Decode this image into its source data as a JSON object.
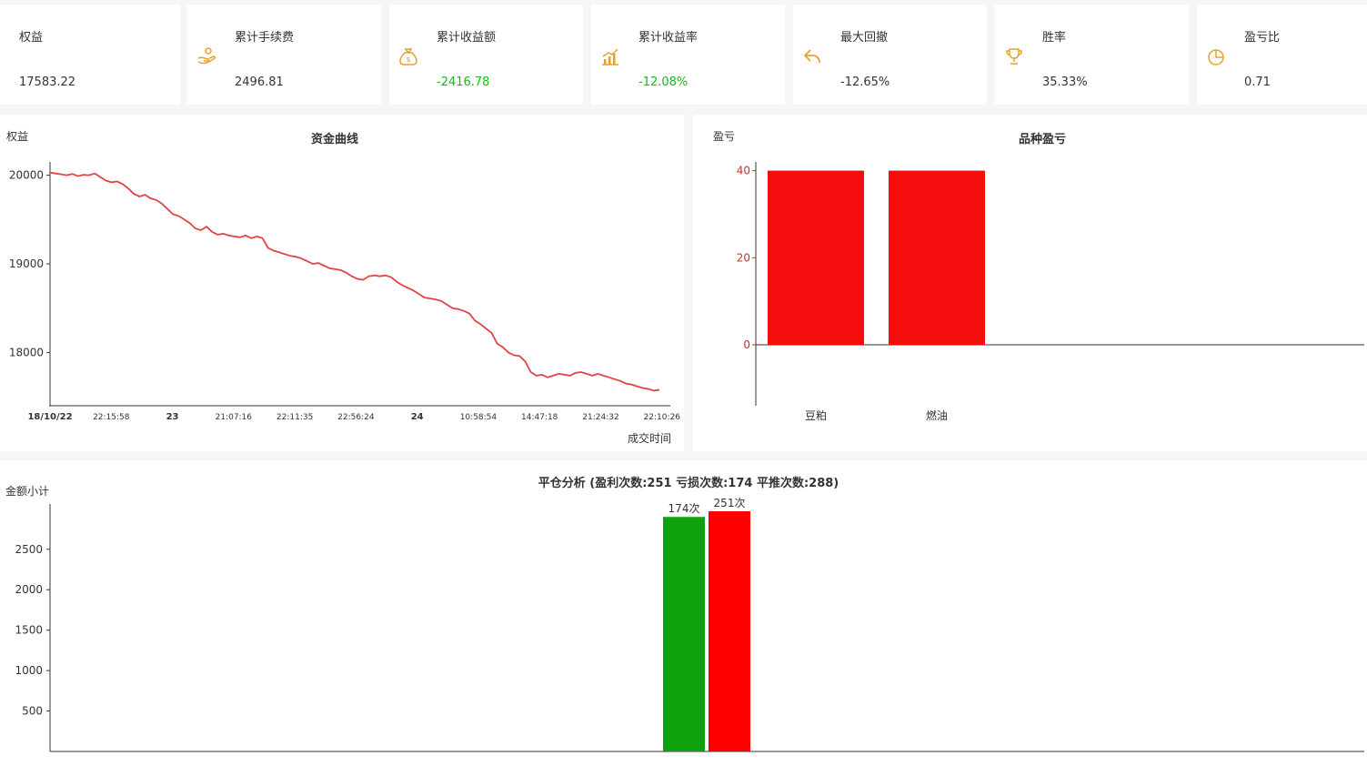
{
  "colors": {
    "accent": "#e8a02a",
    "negative": "#19b919",
    "line": "#e04545",
    "bar_red": "#f50d0d",
    "bar_green": "#0ea10e",
    "bar_red2": "#ff0000"
  },
  "stats": [
    {
      "label": "权益",
      "value": "17583.22",
      "icon": "coins-icon",
      "tone": "normal"
    },
    {
      "label": "累计手续费",
      "value": "2496.81",
      "icon": "hand-coin-icon",
      "tone": "normal"
    },
    {
      "label": "累计收益额",
      "value": "-2416.78",
      "icon": "money-bag-icon",
      "tone": "negative"
    },
    {
      "label": "累计收益率",
      "value": "-12.08%",
      "icon": "rising-chart-icon",
      "tone": "negative"
    },
    {
      "label": "最大回撤",
      "value": "-12.65%",
      "icon": "undo-arrow-icon",
      "tone": "normal"
    },
    {
      "label": "胜率",
      "value": "35.33%",
      "icon": "trophy-icon",
      "tone": "normal"
    },
    {
      "label": "盈亏比",
      "value": "0.71",
      "icon": "pie-chart-icon",
      "tone": "normal"
    }
  ],
  "chart_data": [
    {
      "type": "line",
      "title": "资金曲线",
      "ylabel": "权益",
      "xlabel": "成交时间",
      "ylim": [
        17400,
        20150
      ],
      "yticks": [
        18000,
        19000,
        20000
      ],
      "xticks": [
        "18/10/22",
        "22:15:58",
        "23",
        "21:07:16",
        "22:11:35",
        "22:56:24",
        "24",
        "10:58:54",
        "14:47:18",
        "21:24:32",
        "22:10:26"
      ],
      "xticks_bold": [
        "18/10/22",
        "23",
        "24"
      ],
      "grid": false,
      "values": [
        20030,
        20020,
        20010,
        20000,
        20015,
        19990,
        20005,
        20000,
        20020,
        19980,
        19940,
        19920,
        19930,
        19900,
        19850,
        19790,
        19760,
        19780,
        19740,
        19720,
        19680,
        19620,
        19560,
        19540,
        19500,
        19460,
        19400,
        19380,
        19420,
        19360,
        19330,
        19340,
        19320,
        19310,
        19300,
        19320,
        19290,
        19310,
        19290,
        19180,
        19150,
        19130,
        19110,
        19090,
        19080,
        19060,
        19030,
        19000,
        19010,
        18980,
        18950,
        18940,
        18930,
        18900,
        18860,
        18830,
        18820,
        18860,
        18870,
        18860,
        18870,
        18850,
        18800,
        18760,
        18730,
        18700,
        18660,
        18620,
        18610,
        18600,
        18580,
        18540,
        18500,
        18490,
        18470,
        18440,
        18360,
        18320,
        18270,
        18220,
        18100,
        18060,
        18000,
        17970,
        17960,
        17900,
        17780,
        17740,
        17750,
        17720,
        17740,
        17760,
        17750,
        17740,
        17770,
        17780,
        17760,
        17740,
        17760,
        17740,
        17720,
        17700,
        17680,
        17650,
        17640,
        17620,
        17600,
        17590,
        17570,
        17580
      ]
    },
    {
      "type": "bar",
      "title": "品种盈亏",
      "ylabel": "盈亏",
      "categories": [
        "豆粕",
        "燃油"
      ],
      "values": [
        40,
        40
      ],
      "ylim": [
        -14,
        42
      ],
      "yticks": [
        0,
        20,
        40
      ]
    },
    {
      "type": "bar",
      "title": "平仓分析 (盈利次数:251 亏损次数:174 平推次数:288)",
      "ylabel": "金额小计",
      "ylim": [
        0,
        3060
      ],
      "yticks": [
        500,
        1000,
        1500,
        2000,
        2500
      ],
      "series": [
        {
          "value": 2900,
          "label": "174次"
        },
        {
          "value": 2970,
          "label": "251次"
        }
      ]
    }
  ]
}
